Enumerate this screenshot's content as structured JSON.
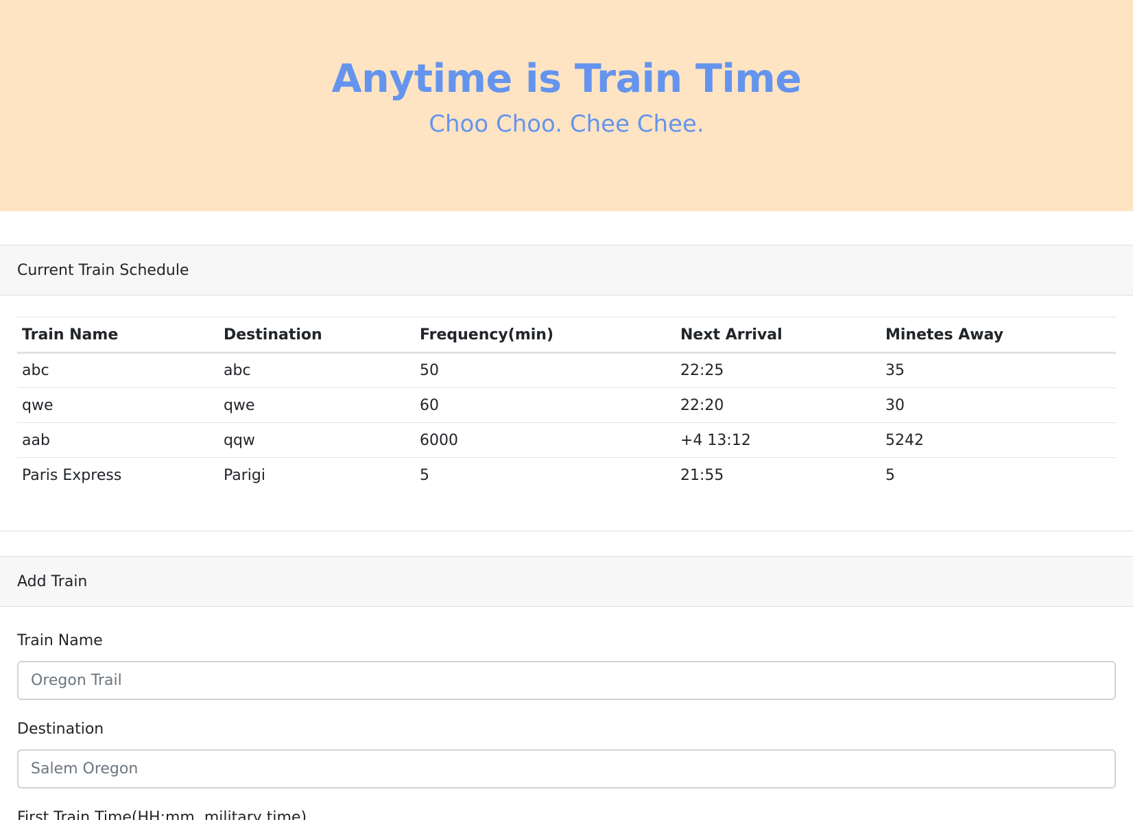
{
  "hero": {
    "title": "Anytime is Train Time",
    "subtitle": "Choo Choo. Chee Chee."
  },
  "schedule": {
    "header": "Current Train Schedule",
    "columns": [
      "Train Name",
      "Destination",
      "Frequency(min)",
      "Next Arrival",
      "Minetes Away"
    ],
    "rows": [
      [
        "abc",
        "abc",
        "50",
        "22:25",
        "35"
      ],
      [
        "qwe",
        "qwe",
        "60",
        "22:20",
        "30"
      ],
      [
        "aab",
        "qqw",
        "6000",
        "+4 13:12",
        "5242"
      ],
      [
        "Paris Express",
        "Parigi",
        "5",
        "21:55",
        "5"
      ]
    ]
  },
  "add_train": {
    "header": "Add Train",
    "name_label": "Train Name",
    "name_placeholder": "Oregon Trail",
    "destination_label": "Destination",
    "destination_placeholder": "Salem Oregon",
    "first_time_label": "First Train Time(HH:mm, military time)"
  },
  "colors": {
    "hero_bg": "#ffe4c3",
    "hero_text": "#6494ed",
    "card_header_bg": "#f7f7f7"
  }
}
